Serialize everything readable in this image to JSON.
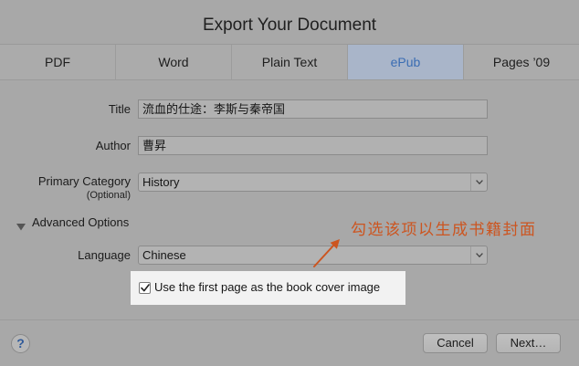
{
  "dialog": {
    "title": "Export Your Document",
    "tabs": [
      {
        "label": "PDF",
        "selected": false
      },
      {
        "label": "Word",
        "selected": false
      },
      {
        "label": "Plain Text",
        "selected": false
      },
      {
        "label": "ePub",
        "selected": true
      },
      {
        "label": "Pages ’09",
        "selected": false
      }
    ],
    "form": {
      "title": {
        "label": "Title",
        "value": "流血的仕途：李斯与秦帝国"
      },
      "author": {
        "label": "Author",
        "value": "曹昇"
      },
      "primary_category": {
        "label": "Primary Category",
        "note": "(Optional)",
        "value": "History"
      },
      "advanced_options": {
        "label": "Advanced Options",
        "expanded": true
      },
      "language": {
        "label": "Language",
        "value": "Chinese"
      },
      "cover_checkbox": {
        "label": "Use the first page as the book cover image",
        "checked": true
      }
    },
    "buttons": {
      "help": "?",
      "cancel": "Cancel",
      "next": "Next…"
    }
  },
  "annotation": {
    "text": "勾选该项以生成书籍封面"
  },
  "icons": {
    "popup_arrow": "chevron-down-icon",
    "disclosure": "disclosure-triangle-icon",
    "checkbox": "checkmark-icon",
    "help": "question-mark-icon",
    "annotation_arrow": "arrow-icon"
  },
  "colors": {
    "background": "#a8a8a8",
    "field": "#b1b1b1",
    "selected_tab": "#a9b5c9",
    "selected_tab_text": "#3a6db3",
    "highlight": "#f2f2f2",
    "annotation": "#cc5520"
  }
}
